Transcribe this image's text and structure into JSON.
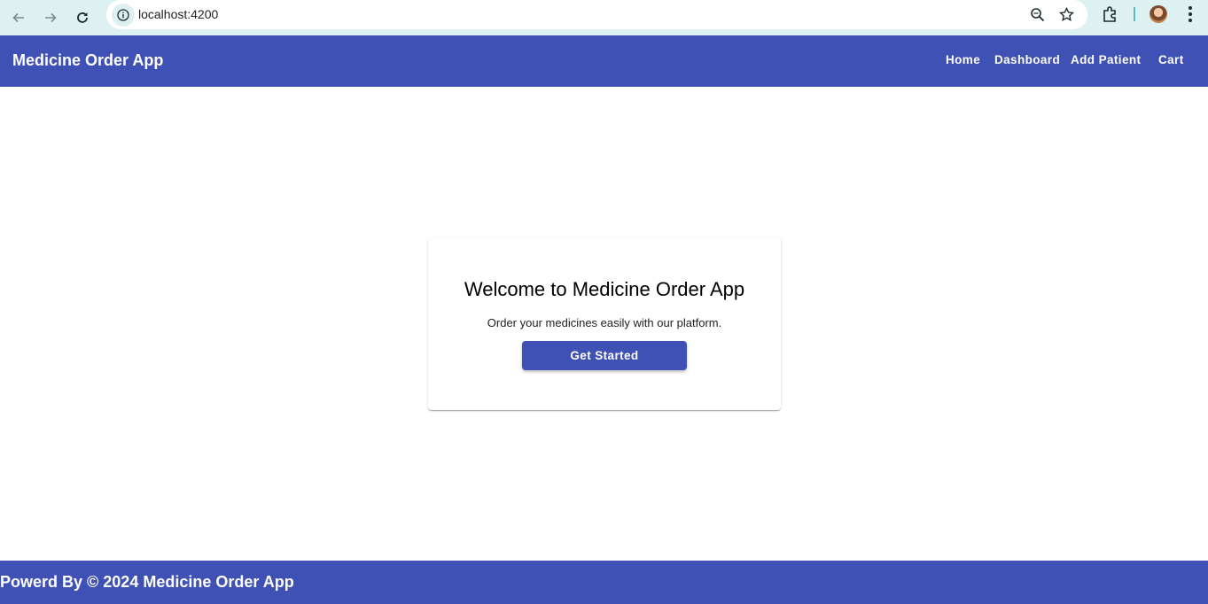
{
  "browser": {
    "url": "localhost:4200",
    "icons": [
      "back-arrow-icon",
      "forward-arrow-icon",
      "reload-icon",
      "info-icon",
      "zoom-icon",
      "star-icon",
      "extensions-icon",
      "profile-avatar",
      "menu-icon"
    ]
  },
  "toolbar": {
    "title": "Medicine Order App",
    "links": {
      "home": "Home",
      "dashboard": "Dashboard",
      "add_patient": "Add Patient",
      "cart": "Cart"
    },
    "color": "#3f51b5"
  },
  "welcome_card": {
    "title": "Welcome to Medicine Order App",
    "subtitle": "Order your medicines easily with our platform.",
    "button_label": "Get Started"
  },
  "footer": {
    "text": "Powerd By © 2024 Medicine Order App"
  }
}
